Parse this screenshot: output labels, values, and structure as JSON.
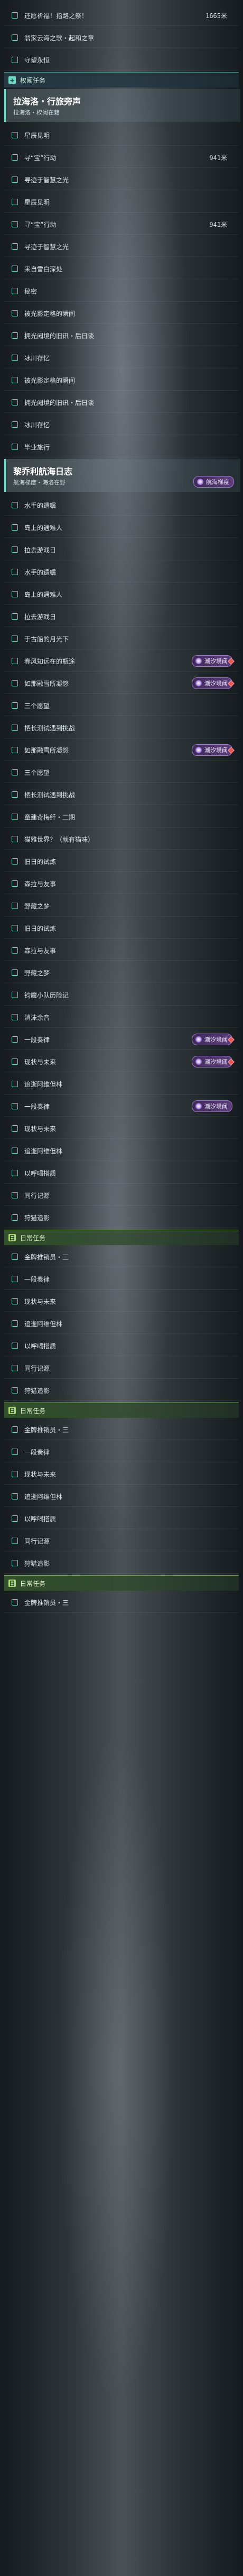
{
  "blocks": [
    {
      "kind": "row",
      "label": "还愿祈福！指路之祭！",
      "dist": "1665米"
    },
    {
      "kind": "row",
      "label": "翁家云海之歌・起和之章"
    },
    {
      "kind": "row",
      "label": "守望永恒"
    },
    {
      "kind": "section",
      "variant": "main",
      "icon": "+",
      "text": "权阈任务"
    },
    {
      "kind": "header",
      "title": "拉海洛・行旅旁声",
      "subtitle": "拉海洛・权阈在籍"
    },
    {
      "kind": "row",
      "label": "星辰见明"
    },
    {
      "kind": "row",
      "label": "寻“宝”行动",
      "dist": "941米"
    },
    {
      "kind": "row",
      "label": "寻迹于智慧之光"
    },
    {
      "kind": "row",
      "label": "星辰见明"
    },
    {
      "kind": "row",
      "label": "寻“宝”行动",
      "dist": "941米"
    },
    {
      "kind": "row",
      "label": "寻迹于智慧之光"
    },
    {
      "kind": "row",
      "label": "来自雪白深处"
    },
    {
      "kind": "row",
      "label": "秘密"
    },
    {
      "kind": "row",
      "label": "被光影定格的瞬间"
    },
    {
      "kind": "row",
      "label": "拥光阙境的旧讯・后日谈"
    },
    {
      "kind": "row",
      "label": "冰川存忆"
    },
    {
      "kind": "row",
      "label": "被光影定格的瞬间"
    },
    {
      "kind": "row",
      "label": "拥光阙境的旧讯・后日谈"
    },
    {
      "kind": "row",
      "label": "冰川存忆"
    },
    {
      "kind": "row",
      "label": "毕业旅行"
    },
    {
      "kind": "header",
      "title": "黎乔利航海日志",
      "subtitle": "航海梯度・海洛在野",
      "badge": "航海梯度"
    },
    {
      "kind": "row",
      "label": "水手的遗嘱"
    },
    {
      "kind": "row",
      "label": "岛上的遇难人"
    },
    {
      "kind": "row",
      "label": "拉去游戏日"
    },
    {
      "kind": "row",
      "label": "水手的遗嘱"
    },
    {
      "kind": "row",
      "label": "岛上的遇难人"
    },
    {
      "kind": "row",
      "label": "拉去游戏日"
    },
    {
      "kind": "row",
      "label": "于古船的月光下"
    },
    {
      "kind": "row",
      "label": "春风知远在的瓶途",
      "badge": "潮汐境阈",
      "diamond": true
    },
    {
      "kind": "row",
      "label": "如那融雪所凝怨",
      "badge": "潮汐境阈",
      "diamond": true
    },
    {
      "kind": "row",
      "label": "三个愿望"
    },
    {
      "kind": "row",
      "label": "栖长测试遇到挑战"
    },
    {
      "kind": "row",
      "label": "如那融雪所凝怨",
      "badge": "潮汐境阈",
      "diamond": true
    },
    {
      "kind": "row",
      "label": "三个愿望"
    },
    {
      "kind": "row",
      "label": "栖长测试遇到挑战"
    },
    {
      "kind": "row",
      "label": "童建奇梅纤・二期"
    },
    {
      "kind": "row",
      "label": "猫雅世界？（就有猫味）"
    },
    {
      "kind": "row",
      "label": "旧日的试炼"
    },
    {
      "kind": "row",
      "label": "森拉与友事"
    },
    {
      "kind": "row",
      "label": "野藏之梦"
    },
    {
      "kind": "row",
      "label": "旧日的试炼"
    },
    {
      "kind": "row",
      "label": "森拉与友事"
    },
    {
      "kind": "row",
      "label": "野藏之梦"
    },
    {
      "kind": "row",
      "label": "钧魔小队历险记"
    },
    {
      "kind": "row",
      "label": "消沫余音"
    },
    {
      "kind": "row",
      "label": "一段奏律",
      "badge": "潮汐境阈",
      "diamond": true
    },
    {
      "kind": "row",
      "label": "现状与未来",
      "badge": "潮汐境阈",
      "diamond": true
    },
    {
      "kind": "row",
      "label": "追逝阿维但林"
    },
    {
      "kind": "row",
      "label": "一段奏律",
      "badge": "潮汐境阈"
    },
    {
      "kind": "row",
      "label": "现状与未来"
    },
    {
      "kind": "row",
      "label": "追逝阿维但林"
    },
    {
      "kind": "row",
      "label": "以呼喝搭质"
    },
    {
      "kind": "row",
      "label": "同行记源"
    },
    {
      "kind": "row",
      "label": "狩猎追影"
    },
    {
      "kind": "section",
      "variant": "daily",
      "icon": "日",
      "text": "日常任务"
    },
    {
      "kind": "row",
      "label": "金牌推销员・三"
    },
    {
      "kind": "row",
      "label": "一段奏律"
    },
    {
      "kind": "row",
      "label": "现状与未来"
    },
    {
      "kind": "row",
      "label": "追逝阿维但林"
    },
    {
      "kind": "row",
      "label": "以呼喝搭质"
    },
    {
      "kind": "row",
      "label": "同行记源"
    },
    {
      "kind": "row",
      "label": "狩猎追影"
    },
    {
      "kind": "section",
      "variant": "daily",
      "icon": "日",
      "text": "日常任务"
    },
    {
      "kind": "row",
      "label": "金牌推销员・三"
    },
    {
      "kind": "row",
      "label": "一段奏律"
    },
    {
      "kind": "row",
      "label": "现状与未来"
    },
    {
      "kind": "row",
      "label": "追逝阿维但林"
    },
    {
      "kind": "row",
      "label": "以呼喝搭质"
    },
    {
      "kind": "row",
      "label": "同行记源"
    },
    {
      "kind": "row",
      "label": "狩猎追影"
    },
    {
      "kind": "section",
      "variant": "daily",
      "icon": "日",
      "text": "日常任务"
    },
    {
      "kind": "row",
      "label": "金牌推销员・三"
    }
  ]
}
